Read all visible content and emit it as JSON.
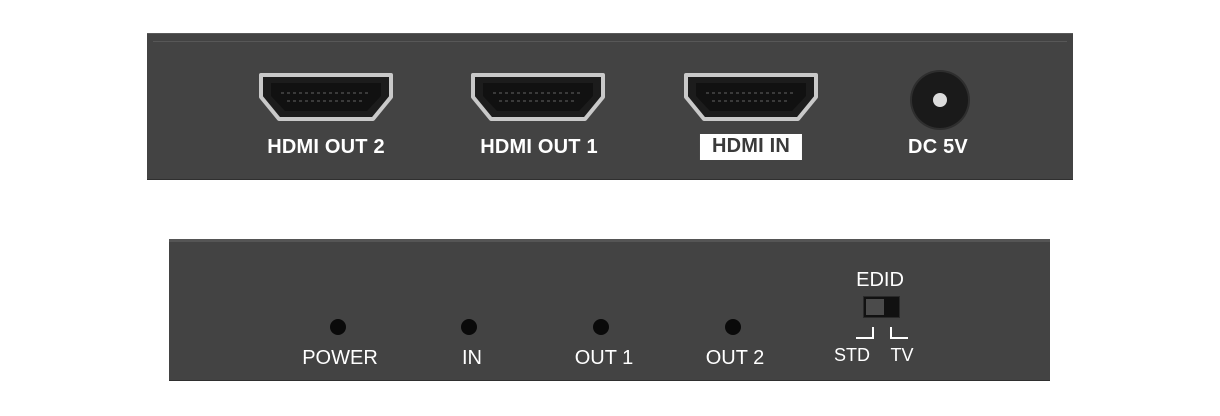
{
  "rear_panel": {
    "ports": [
      {
        "label": "HDMI OUT 2"
      },
      {
        "label": "HDMI OUT 1"
      },
      {
        "label": "HDMI IN"
      }
    ],
    "dc_label": "DC 5V"
  },
  "front_panel": {
    "indicators": [
      {
        "label": "POWER"
      },
      {
        "label": "IN"
      },
      {
        "label": "OUT 1"
      },
      {
        "label": "OUT 2"
      }
    ],
    "edid": {
      "title": "EDID",
      "options": [
        "STD",
        "TV"
      ],
      "selected": "STD"
    }
  },
  "colors": {
    "panel": "#434343",
    "led": "#0a0a0a",
    "highlight_label_bg": "#ffffff"
  }
}
